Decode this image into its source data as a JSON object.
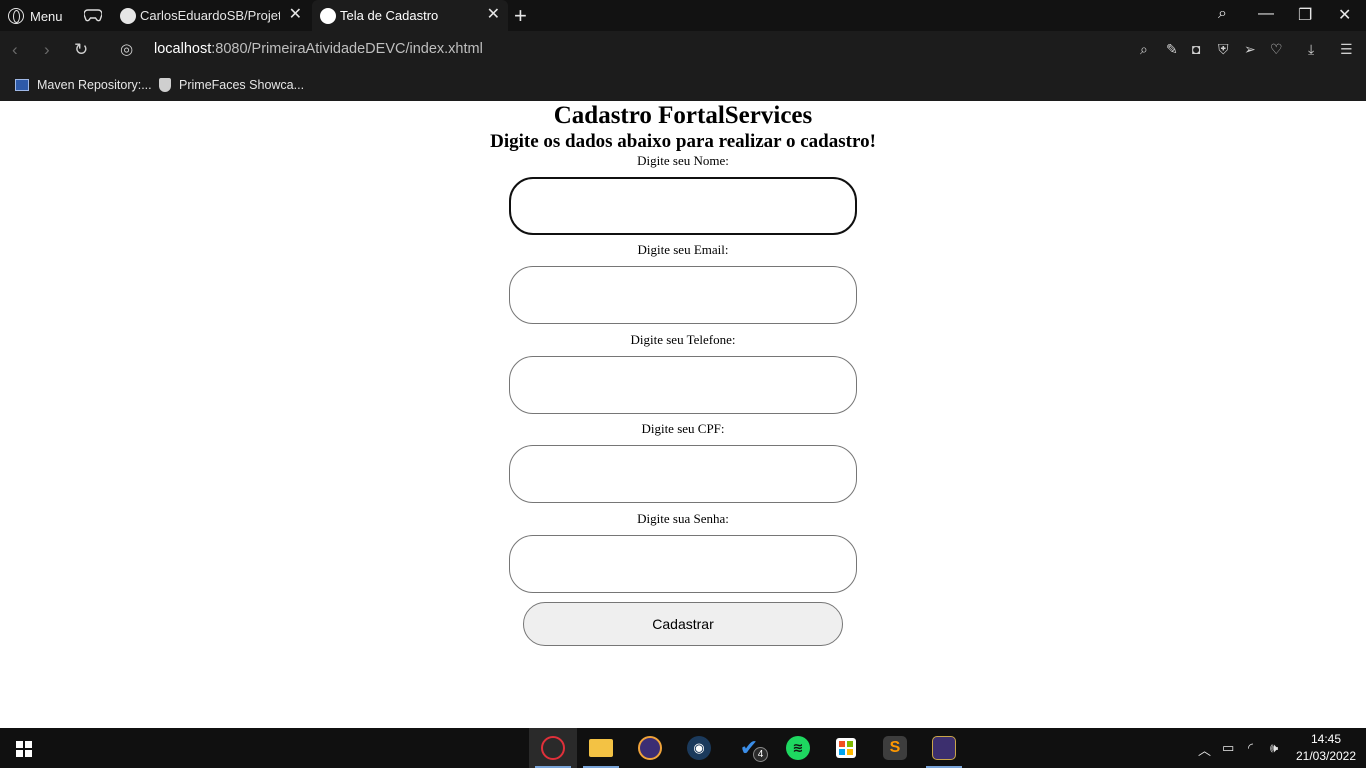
{
  "browser": {
    "menu_label": "Menu",
    "tabs": [
      {
        "title": "CarlosEduardoSB/ProjetoW",
        "favicon": "github-icon"
      },
      {
        "title": "Tela de Cadastro",
        "favicon": "globe-icon",
        "active": true
      }
    ],
    "url": {
      "host": "localhost",
      "rest": ":8080/PrimeiraAtividadeDEVC/index.xhtml"
    },
    "bookmarks": [
      {
        "label": "Maven Repository:...",
        "icon": "maven-icon"
      },
      {
        "label": "PrimeFaces Showca...",
        "icon": "primefaces-icon"
      }
    ]
  },
  "page": {
    "title": "Cadastro FortalServices",
    "subtitle": "Digite os dados abaixo para realizar o cadastro!",
    "fields": [
      {
        "label": "Digite seu Nome:",
        "value": "",
        "focused": true
      },
      {
        "label": "Digite seu Email:",
        "value": ""
      },
      {
        "label": "Digite seu Telefone:",
        "value": ""
      },
      {
        "label": "Digite seu CPF:",
        "value": ""
      },
      {
        "label": "Digite sua Senha:",
        "value": ""
      }
    ],
    "submit_label": "Cadastrar"
  },
  "taskbar": {
    "apps": [
      "opera-icon",
      "file-explorer-icon",
      "eclipse-icon",
      "steam-icon",
      "todo-icon",
      "spotify-icon",
      "microsoft-store-icon",
      "sublime-text-icon",
      "game-app-icon"
    ],
    "todo_badge": "4",
    "time": "14:45",
    "date": "21/03/2022"
  },
  "colors": {
    "chrome_bg": "#1c1c1c",
    "tabbar_bg": "#121212",
    "taskbar_bg": "#101010",
    "button_bg": "#efefef",
    "field_border": "#767676"
  }
}
